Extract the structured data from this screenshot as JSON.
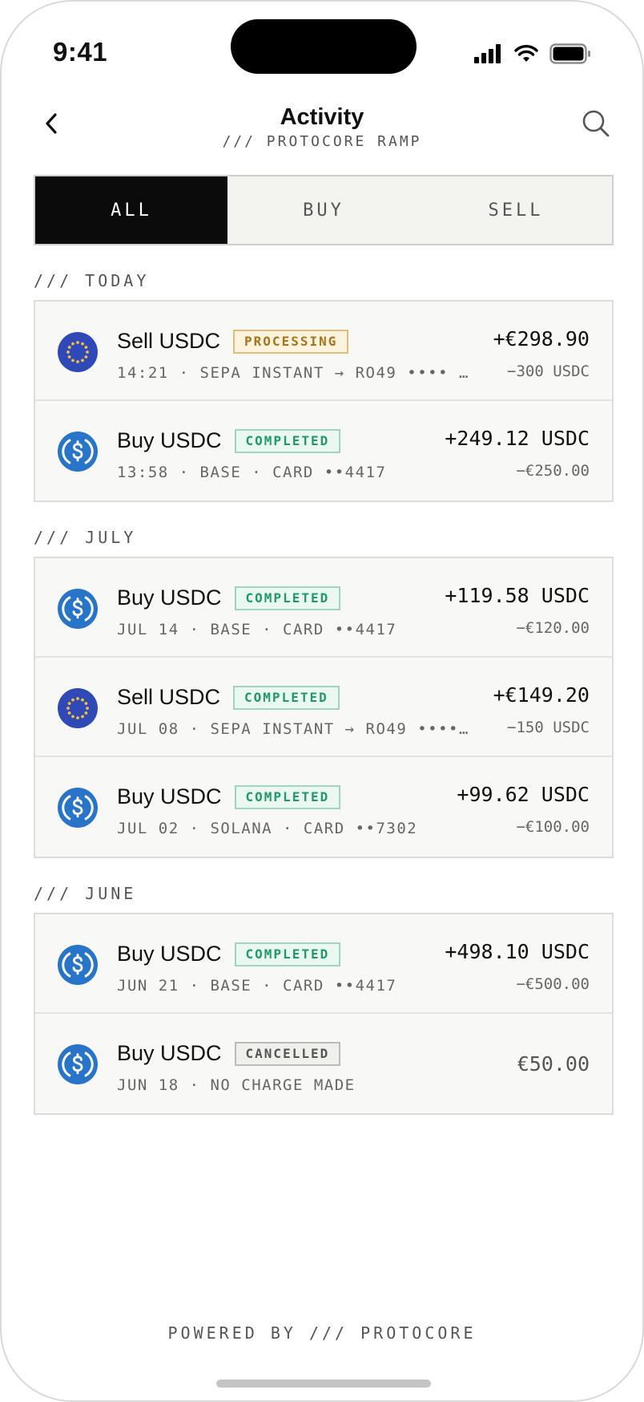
{
  "status_bar": {
    "time": "9:41"
  },
  "header": {
    "title": "Activity",
    "subtitle": "/// PROTOCORE RAMP"
  },
  "tabs": [
    {
      "label": "ALL",
      "active": true
    },
    {
      "label": "BUY",
      "active": false
    },
    {
      "label": "SELL",
      "active": false
    }
  ],
  "sections": [
    {
      "label": "/// TODAY",
      "rows": [
        {
          "icon": "eur-coin-icon",
          "name": "Sell USDC",
          "status": "PROCESSING",
          "status_kind": "processing",
          "meta": "14:21 · SEPA INSTANT → RO49 •••• …",
          "amount": "+€298.90",
          "sub": "−300 USDC"
        },
        {
          "icon": "usdc-coin-icon",
          "name": "Buy USDC",
          "status": "COMPLETED",
          "status_kind": "completed",
          "meta": "13:58 · BASE · CARD ••4417",
          "amount": "+249.12 USDC",
          "sub": "−€250.00"
        }
      ]
    },
    {
      "label": "/// JULY",
      "rows": [
        {
          "icon": "usdc-coin-icon",
          "name": "Buy USDC",
          "status": "COMPLETED",
          "status_kind": "completed",
          "meta": "JUL 14 · BASE · CARD ••4417",
          "amount": "+119.58 USDC",
          "sub": "−€120.00"
        },
        {
          "icon": "eur-coin-icon",
          "name": "Sell USDC",
          "status": "COMPLETED",
          "status_kind": "completed",
          "meta": "JUL 08 · SEPA INSTANT → RO49 ••••…",
          "amount": "+€149.20",
          "sub": "−150 USDC"
        },
        {
          "icon": "usdc-coin-icon",
          "name": "Buy USDC",
          "status": "COMPLETED",
          "status_kind": "completed",
          "meta": "JUL 02 · SOLANA · CARD ••7302",
          "amount": "+99.62 USDC",
          "sub": "−€100.00"
        }
      ]
    },
    {
      "label": "/// JUNE",
      "rows": [
        {
          "icon": "usdc-coin-icon",
          "name": "Buy USDC",
          "status": "COMPLETED",
          "status_kind": "completed",
          "meta": "JUN 21 · BASE · CARD ••4417",
          "amount": "+498.10 USDC",
          "sub": "−€500.00"
        },
        {
          "icon": "usdc-coin-icon",
          "name": "Buy USDC",
          "status": "CANCELLED",
          "status_kind": "cancelled",
          "meta": "JUN 18 · NO CHARGE MADE",
          "amount": "€50.00",
          "sub": ""
        }
      ]
    }
  ],
  "footer": "POWERED BY /// PROTOCORE",
  "colors": {
    "usdc_blue": "#2775ca",
    "eur_blue": "#2f49b8",
    "eur_star": "#f2c230",
    "active_tab": "#0b0b0b"
  }
}
